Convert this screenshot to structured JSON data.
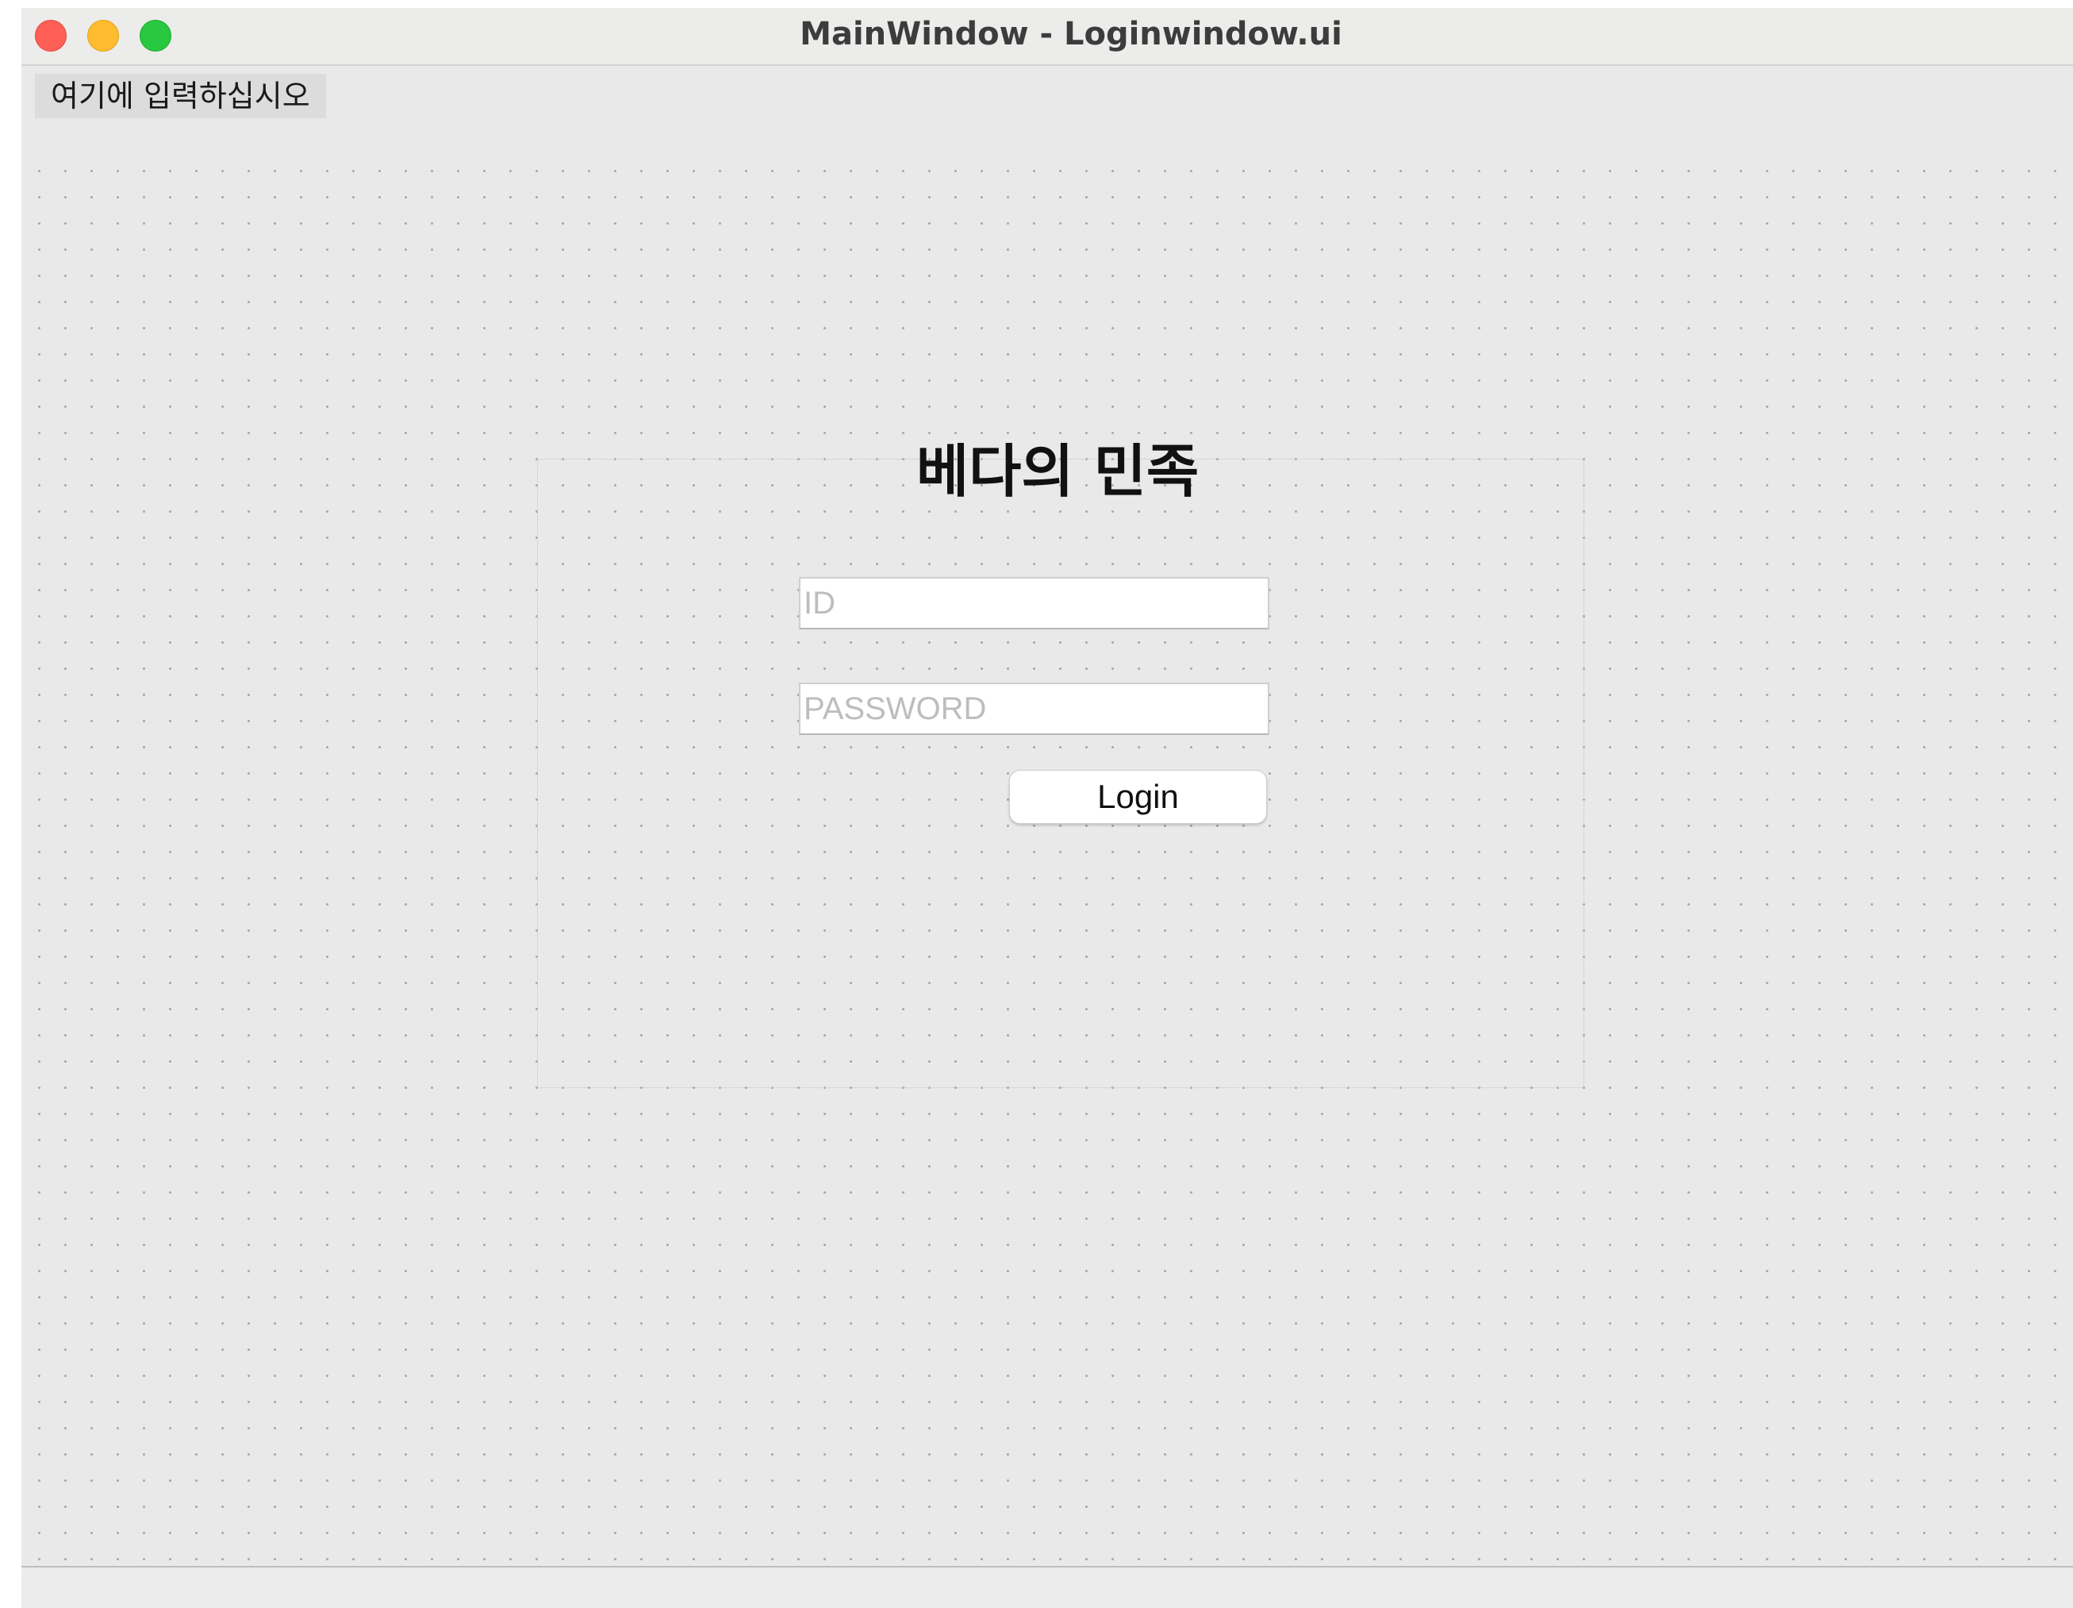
{
  "window": {
    "title": "MainWindow - Loginwindow.ui",
    "controls": [
      "close",
      "minimize",
      "maximize"
    ]
  },
  "menubar": {
    "items": [
      {
        "label": "여기에 입력하십시오"
      }
    ]
  },
  "form": {
    "title": "베다의 민족",
    "id_field": {
      "value": "",
      "placeholder": "ID"
    },
    "password_field": {
      "value": "",
      "placeholder": "PASSWORD"
    },
    "login_button": "Login"
  },
  "colors": {
    "close": "#ff5f57",
    "minimize": "#febc2e",
    "maximize": "#28c840",
    "window_bg": "#e9e9e9"
  }
}
